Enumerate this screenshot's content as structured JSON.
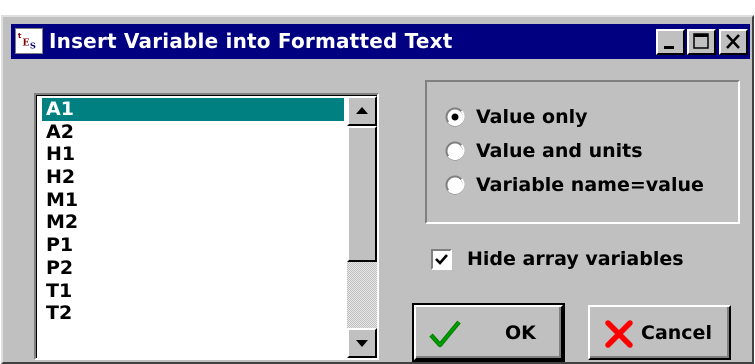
{
  "window": {
    "title": "Insert Variable into Formatted Text",
    "app_icon": "ees-app-icon",
    "controls": {
      "minimize": "minimize-icon",
      "maximize": "maximize-icon",
      "close": "close-icon"
    }
  },
  "variable_list": {
    "items": [
      "A1",
      "A2",
      "H1",
      "H2",
      "M1",
      "M2",
      "P1",
      "P2",
      "T1",
      "T2"
    ],
    "selected": "A1"
  },
  "display_options": {
    "selected": "Value only",
    "options": [
      "Value only",
      "Value and units",
      "Variable name=value"
    ]
  },
  "hide_array_variables": {
    "label": "Hide array variables",
    "checked": true
  },
  "buttons": {
    "ok": {
      "label": "OK",
      "icon": "checkmark-icon"
    },
    "cancel": {
      "label": "Cancel",
      "icon": "red-x-icon"
    }
  },
  "colors": {
    "titlebar": "#000080",
    "selection": "#008080",
    "face": "#c0c0c0",
    "ok_icon": "#008000",
    "cancel_icon": "#ff0000"
  }
}
